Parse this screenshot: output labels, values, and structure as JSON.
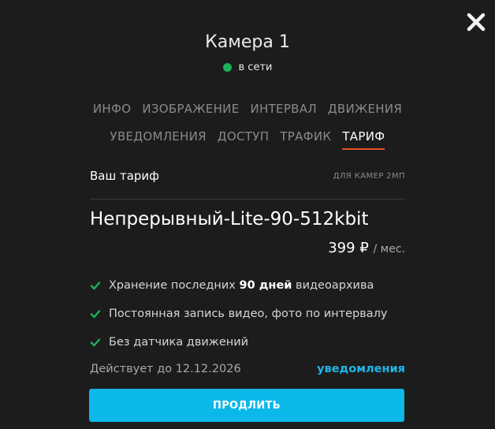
{
  "camera": {
    "title": "Камера 1",
    "status": "в сети",
    "status_color": "#19b35a"
  },
  "tabs_row1": [
    "ИНФО",
    "ИЗОБРАЖЕНИЕ",
    "ИНТЕРВАЛ",
    "ДВИЖЕНИЯ"
  ],
  "tabs_row2": [
    "УВЕДОМЛЕНИЯ",
    "ДОСТУП",
    "ТРАФИК",
    "ТАРИФ"
  ],
  "active_tab": "ТАРИФ",
  "plan": {
    "label": "Ваш тариф",
    "camera_type": "ДЛЯ КАМЕР 2МП",
    "name": "Непрерывный-Lite-90-512kbit",
    "price": "399 ₽",
    "period": "/ мес.",
    "features": [
      {
        "before": "Хранение последних ",
        "bold": "90 дней",
        "after": " видеоархива"
      },
      {
        "before": "Постоянная запись видео, фото по интервалу",
        "bold": "",
        "after": ""
      },
      {
        "before": "Без датчика движений",
        "bold": "",
        "after": ""
      }
    ],
    "valid_until": "Действует до 12.12.2026",
    "notifications_link": "уведомления",
    "renew_button": "ПРОДЛИТЬ"
  },
  "colors": {
    "background": "#1c1c1c",
    "accent": "#0bb8ea",
    "active_tab_underline": "#e2532a",
    "check": "#19b35a"
  },
  "icons": {
    "close": "close-icon",
    "check": "check-icon",
    "status": "status-dot-icon"
  }
}
